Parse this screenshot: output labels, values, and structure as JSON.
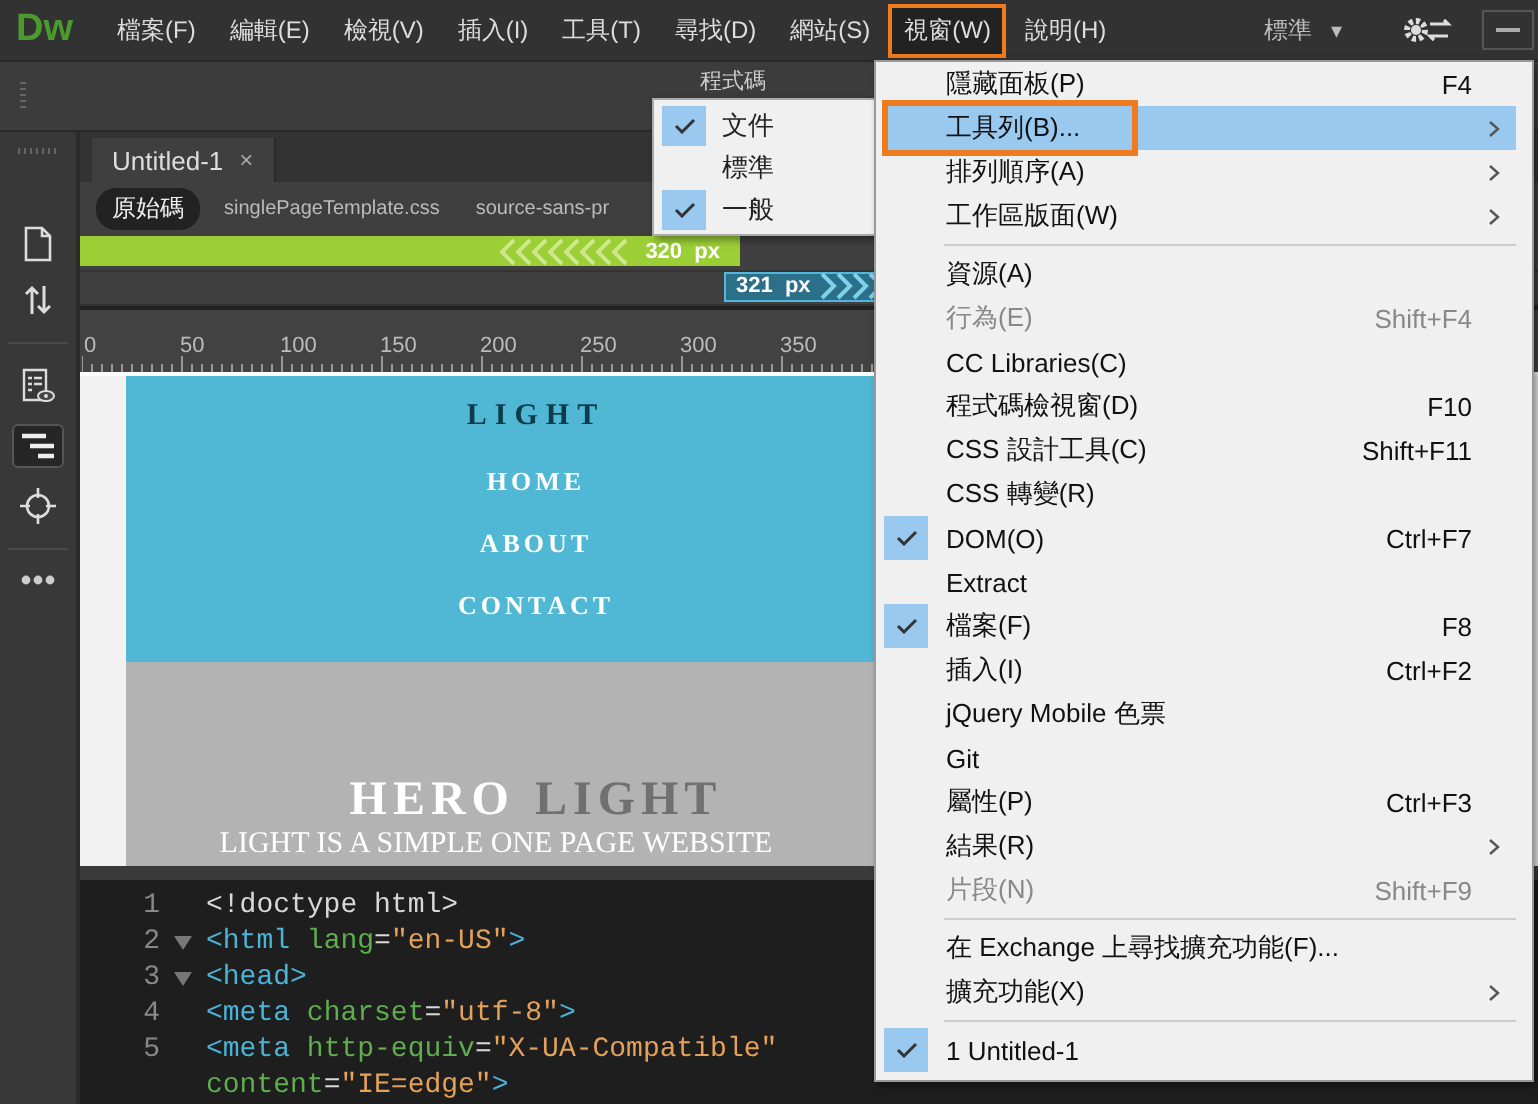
{
  "app_logo": "Dw",
  "menu_bar": [
    {
      "label": "檔案(F)",
      "selected": false,
      "callout": false
    },
    {
      "label": "編輯(E)",
      "selected": false,
      "callout": false
    },
    {
      "label": "檢視(V)",
      "selected": false,
      "callout": false
    },
    {
      "label": "插入(I)",
      "selected": false,
      "callout": false
    },
    {
      "label": "工具(T)",
      "selected": false,
      "callout": false
    },
    {
      "label": "尋找(D)",
      "selected": false,
      "callout": false
    },
    {
      "label": "網站(S)",
      "selected": false,
      "callout": false
    },
    {
      "label": "視窗(W)",
      "selected": true,
      "callout": true
    },
    {
      "label": "說明(H)",
      "selected": false,
      "callout": false
    }
  ],
  "workspace": {
    "label": "標準",
    "caret": "▾"
  },
  "toolbar": {
    "view_label": "程式碼"
  },
  "document_tab": {
    "title": "Untitled-1",
    "close": "×"
  },
  "related_files": [
    {
      "label": "原始碼",
      "selected": true
    },
    {
      "label": "singlePageTemplate.css",
      "selected": false
    },
    {
      "label": "source-sans-pr",
      "selected": false
    }
  ],
  "media_queries": [
    {
      "kind": "max",
      "value": "320",
      "unit": "px"
    },
    {
      "kind": "min",
      "value": "321",
      "unit": "px"
    }
  ],
  "ruler": [
    "0",
    "50",
    "100",
    "150",
    "200",
    "250",
    "300",
    "350"
  ],
  "preview": {
    "logo": "LIGHT",
    "nav": [
      "HOME",
      "ABOUT",
      "CONTACT"
    ],
    "hero_title": [
      {
        "text": "HERO",
        "kind": "light"
      },
      {
        "text": "LIGHT",
        "kind": "dark"
      }
    ],
    "tagline": "LIGHT IS A SIMPLE ONE PAGE WEBSITE"
  },
  "code_lines": [
    {
      "number": "1",
      "foldable": false,
      "parts": [
        {
          "kind": "text",
          "text": "<!doctype html>"
        }
      ]
    },
    {
      "number": "2",
      "foldable": true,
      "parts": [
        {
          "kind": "tag",
          "text": "<html"
        },
        {
          "kind": "attr",
          "text": " lang"
        },
        {
          "kind": "text",
          "text": "="
        },
        {
          "kind": "value",
          "text": "\"en-US\""
        },
        {
          "kind": "tag",
          "text": ">"
        }
      ]
    },
    {
      "number": "3",
      "foldable": true,
      "parts": [
        {
          "kind": "tag",
          "text": "<head>"
        }
      ]
    },
    {
      "number": "4",
      "foldable": false,
      "parts": [
        {
          "kind": "tag",
          "text": "<meta"
        },
        {
          "kind": "attr",
          "text": " charset"
        },
        {
          "kind": "text",
          "text": "="
        },
        {
          "kind": "value",
          "text": "\"utf-8\""
        },
        {
          "kind": "tag",
          "text": ">"
        }
      ]
    },
    {
      "number": "5",
      "foldable": false,
      "parts": [
        {
          "kind": "tag",
          "text": "<meta"
        },
        {
          "kind": "attr",
          "text": " http-equiv"
        },
        {
          "kind": "text",
          "text": "="
        },
        {
          "kind": "value",
          "text": "\"X-UA-Compatible\""
        }
      ]
    },
    {
      "foldable": false,
      "parts": [
        {
          "kind": "attr",
          "text": "content"
        },
        {
          "kind": "text",
          "text": "="
        },
        {
          "kind": "value",
          "text": "\"IE=edge\""
        },
        {
          "kind": "tag",
          "text": ">"
        }
      ]
    }
  ],
  "toolbar_submenu": [
    {
      "label": "文件",
      "checked": true
    },
    {
      "label": "標準",
      "checked": false
    },
    {
      "label": "一般",
      "checked": true
    }
  ],
  "window_menu": [
    {
      "kind": "item",
      "label": "隱藏面板(P)",
      "shortcut": "F4",
      "checked": false,
      "disabled": false,
      "submenu": false,
      "selected": false,
      "callout": false
    },
    {
      "kind": "item",
      "label": "工具列(B)...",
      "checked": false,
      "disabled": false,
      "submenu": true,
      "selected": true,
      "callout": true
    },
    {
      "kind": "item",
      "label": "排列順序(A)",
      "checked": false,
      "disabled": false,
      "submenu": true,
      "selected": false,
      "callout": false
    },
    {
      "kind": "item",
      "label": "工作區版面(W)",
      "checked": false,
      "disabled": false,
      "submenu": true,
      "selected": false,
      "callout": false
    },
    {
      "kind": "separator"
    },
    {
      "kind": "item",
      "label": "資源(A)",
      "checked": false,
      "disabled": false,
      "submenu": false,
      "selected": false,
      "callout": false
    },
    {
      "kind": "item",
      "label": "行為(E)",
      "shortcut": "Shift+F4",
      "checked": false,
      "disabled": true,
      "submenu": false,
      "selected": false,
      "callout": false
    },
    {
      "kind": "item",
      "label": "CC Libraries(C)",
      "checked": false,
      "disabled": false,
      "submenu": false,
      "selected": false,
      "callout": false
    },
    {
      "kind": "item",
      "label": "程式碼檢視窗(D)",
      "shortcut": "F10",
      "checked": false,
      "disabled": false,
      "submenu": false,
      "selected": false,
      "callout": false
    },
    {
      "kind": "item",
      "label": "CSS 設計工具(C)",
      "shortcut": "Shift+F11",
      "checked": false,
      "disabled": false,
      "submenu": false,
      "selected": false,
      "callout": false
    },
    {
      "kind": "item",
      "label": "CSS 轉變(R)",
      "checked": false,
      "disabled": false,
      "submenu": false,
      "selected": false,
      "callout": false
    },
    {
      "kind": "item",
      "label": "DOM(O)",
      "shortcut": "Ctrl+F7",
      "checked": true,
      "disabled": false,
      "submenu": false,
      "selected": false,
      "callout": false
    },
    {
      "kind": "item",
      "label": "Extract",
      "checked": false,
      "disabled": false,
      "submenu": false,
      "selected": false,
      "callout": false
    },
    {
      "kind": "item",
      "label": "檔案(F)",
      "shortcut": "F8",
      "checked": true,
      "disabled": false,
      "submenu": false,
      "selected": false,
      "callout": false
    },
    {
      "kind": "item",
      "label": "插入(I)",
      "shortcut": "Ctrl+F2",
      "checked": false,
      "disabled": false,
      "submenu": false,
      "selected": false,
      "callout": false
    },
    {
      "kind": "item",
      "label": "jQuery Mobile 色票",
      "checked": false,
      "disabled": false,
      "submenu": false,
      "selected": false,
      "callout": false
    },
    {
      "kind": "item",
      "label": "Git",
      "checked": false,
      "disabled": false,
      "submenu": false,
      "selected": false,
      "callout": false
    },
    {
      "kind": "item",
      "label": "屬性(P)",
      "shortcut": "Ctrl+F3",
      "checked": false,
      "disabled": false,
      "submenu": false,
      "selected": false,
      "callout": false
    },
    {
      "kind": "item",
      "label": "結果(R)",
      "checked": false,
      "disabled": false,
      "submenu": true,
      "selected": false,
      "callout": false
    },
    {
      "kind": "item",
      "label": "片段(N)",
      "shortcut": "Shift+F9",
      "checked": false,
      "disabled": true,
      "submenu": false,
      "selected": false,
      "callout": false
    },
    {
      "kind": "separator"
    },
    {
      "kind": "item",
      "label": "在 Exchange 上尋找擴充功能(F)...",
      "checked": false,
      "disabled": false,
      "submenu": false,
      "selected": false,
      "callout": false
    },
    {
      "kind": "item",
      "label": "擴充功能(X)",
      "checked": false,
      "disabled": false,
      "submenu": true,
      "selected": false,
      "callout": false
    },
    {
      "kind": "separator"
    },
    {
      "kind": "item",
      "label": "1 Untitled-1",
      "checked": true,
      "disabled": false,
      "submenu": false,
      "selected": false,
      "callout": false
    }
  ]
}
